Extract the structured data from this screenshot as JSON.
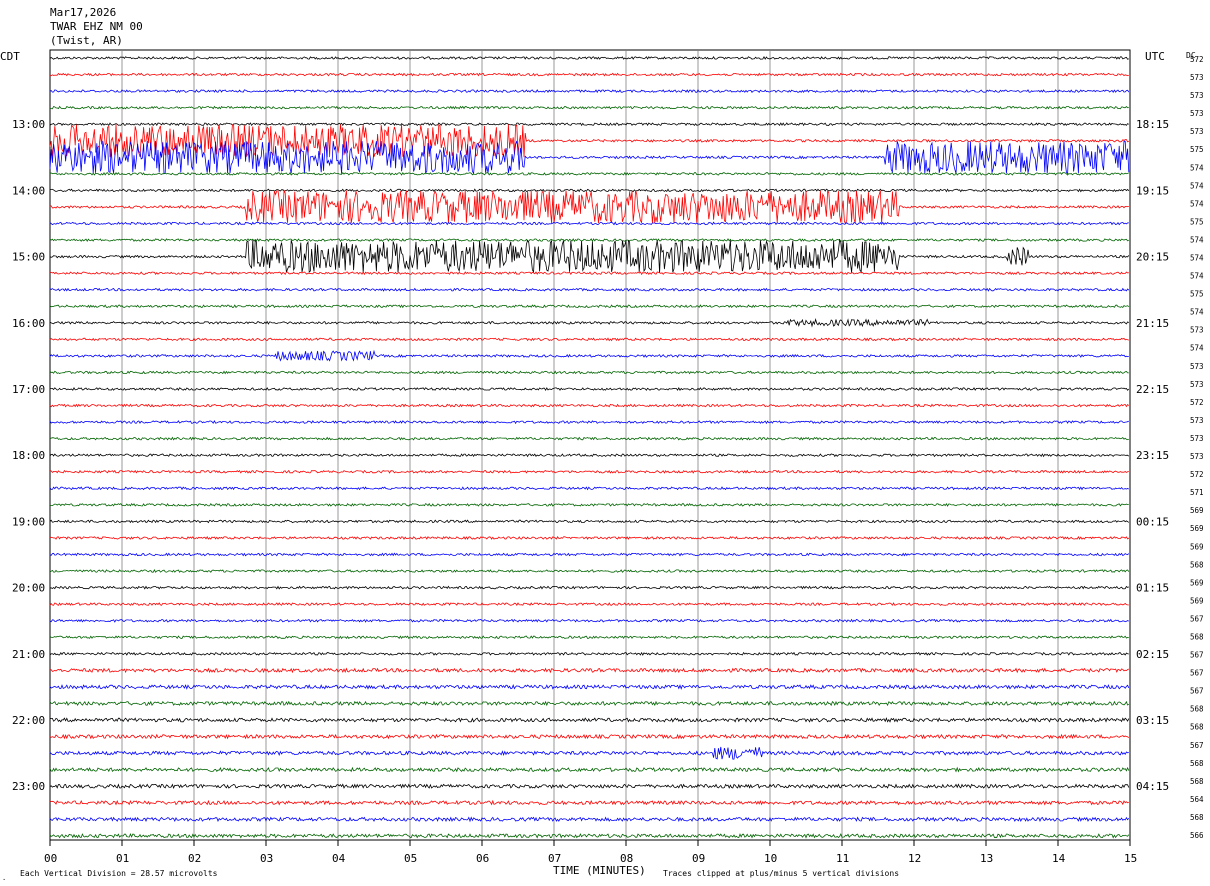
{
  "header": {
    "date": "Mar17,2026",
    "station": "TWAR EHZ NM 00",
    "location": "(Twist, AR)"
  },
  "left_axis_title": "CDT",
  "right_axis_title": "UTC",
  "dc_title": "DC",
  "footer": {
    "scale_note": "Each Vertical Division =   28.57 microvolts",
    "xlabel": "TIME (MINUTES)",
    "clip_note": "Traces clipped at plus/minus 5 vertical divisions"
  },
  "colors": {
    "trace_cycle": [
      "#000000",
      "#ff0000",
      "#0000ff",
      "#006400"
    ],
    "grid": "#808080",
    "text": "#000000"
  },
  "chart_data": {
    "type": "line",
    "title": "",
    "xlabel": "TIME (MINUTES)",
    "ylabel": "",
    "xlim": [
      0,
      15
    ],
    "x_ticks": [
      "00",
      "01",
      "02",
      "03",
      "04",
      "05",
      "06",
      "07",
      "08",
      "09",
      "10",
      "11",
      "12",
      "13",
      "14",
      "15"
    ],
    "rows": 48,
    "minutes_per_row": 15,
    "left_time_labels": [
      "13:00",
      "14:00",
      "15:00",
      "16:00",
      "17:00",
      "18:00",
      "19:00",
      "20:00",
      "21:00",
      "22:00",
      "23:00"
    ],
    "right_time_labels": [
      "18:15",
      "19:15",
      "20:15",
      "21:15",
      "22:15",
      "23:15",
      "00:15",
      "01:15",
      "02:15",
      "03:15",
      "04:15"
    ],
    "dc_offsets": [
      572,
      573,
      573,
      573,
      573,
      575,
      574,
      574,
      574,
      575,
      574,
      574,
      574,
      575,
      574,
      573,
      574,
      573,
      573,
      572,
      573,
      573,
      573,
      572,
      571,
      569,
      569,
      569,
      568,
      569,
      569,
      567,
      568,
      567,
      567,
      567,
      568,
      568,
      567,
      568,
      568,
      564,
      568,
      566
    ],
    "events": [
      {
        "row": 5,
        "color_index": 3,
        "start_min": 0.0,
        "end_min": 6.6,
        "amplitude_div": 5,
        "note": "clipped"
      },
      {
        "row": 6,
        "color_index": 3,
        "start_min": 0.0,
        "end_min": 6.6,
        "amplitude_div": 5,
        "note": "clipped"
      },
      {
        "row": 6,
        "color_index": 2,
        "start_min": 11.6,
        "end_min": 15.0,
        "amplitude_div": 5,
        "note": "clipped"
      },
      {
        "row": 9,
        "color_index": 1,
        "start_min": 2.7,
        "end_min": 11.8,
        "amplitude_div": 5,
        "note": "clipped"
      },
      {
        "row": 12,
        "color_index": 1,
        "start_min": 2.7,
        "end_min": 11.8,
        "amplitude_div": 5,
        "note": "clipped"
      },
      {
        "row": 12,
        "color_index": 0,
        "start_min": 13.3,
        "end_min": 13.6,
        "amplitude_div": 3,
        "note": "burst"
      },
      {
        "row": 16,
        "color_index": 0,
        "start_min": 10.2,
        "end_min": 12.2,
        "amplitude_div": 1,
        "note": "burst"
      },
      {
        "row": 18,
        "color_index": 2,
        "start_min": 3.1,
        "end_min": 4.5,
        "amplitude_div": 1.5,
        "note": "burst"
      },
      {
        "row": 42,
        "color_index": 3,
        "start_min": 9.2,
        "end_min": 9.9,
        "amplitude_div": 2,
        "note": "burst"
      }
    ]
  }
}
